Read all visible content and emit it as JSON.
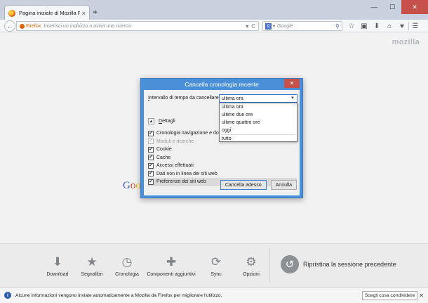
{
  "window": {
    "tab_title": "Pagina iniziale di Mozilla Fir...",
    "tab_close": "×",
    "new_tab": "+",
    "controls": {
      "minimize": "—",
      "maximize": "☐",
      "close": "✕"
    }
  },
  "navbar": {
    "back": "←",
    "identity": "Firefox",
    "url_placeholder": "Inserisci un indirizzo o avvia una ricerca",
    "reload": "C",
    "dropdown": "▾",
    "search_engine": "g",
    "search_placeholder": "Google",
    "search_go": "⚲",
    "tools": {
      "bookmark": "☆",
      "reading": "▣",
      "download": "⬇",
      "home": "⌂",
      "pocket": "♥",
      "menu": "☰"
    }
  },
  "content": {
    "brand": "mozilla",
    "google_logo": [
      "G",
      "o",
      "o"
    ]
  },
  "launcher": {
    "items": [
      {
        "label": "Download",
        "icon": "⬇"
      },
      {
        "label": "Segnalibri",
        "icon": "★"
      },
      {
        "label": "Cronologia",
        "icon": "◷"
      },
      {
        "label": "Componenti aggiuntivi",
        "icon": "✚"
      },
      {
        "label": "Sync",
        "icon": "⟳"
      },
      {
        "label": "Opzioni",
        "icon": "⚙"
      }
    ],
    "restore_icon": "↺",
    "restore_label": "Ripristina la sessione precedente"
  },
  "statusbar": {
    "info_icon": "i",
    "message": "Alcune informazioni vengono inviate automaticamente a Mozilla da Firefox per migliorare l'utilizzo.",
    "choose_button": "Scegli cosa condividere",
    "close": "✕"
  },
  "dialog": {
    "title": "Cancella cronologia recente",
    "close": "✕",
    "range_label_prefix": "I",
    "range_label_rest": "ntervallo di tempo da cancellare:",
    "selected_range": "ultima ora",
    "range_options": [
      "ultima ora",
      "ultime due ore",
      "ultime quattro ore",
      "oggi",
      "tutto"
    ],
    "details_toggle": "▲",
    "details_prefix": "D",
    "details_rest": "ettagli",
    "checks": [
      {
        "label": "Cronologia navigazione e download",
        "checked": "✔",
        "disabled": false
      },
      {
        "label": "Moduli e ricerche",
        "checked": "✔",
        "disabled": true
      },
      {
        "label": "Cookie",
        "checked": "✔",
        "disabled": false
      },
      {
        "label": "Cache",
        "checked": "✔",
        "disabled": false
      },
      {
        "label": "Accessi effettuati",
        "checked": "✔",
        "disabled": false
      },
      {
        "label": "Dati non in linea dei siti web",
        "checked": "✔",
        "disabled": false
      },
      {
        "label": "Preferenze dei siti web",
        "checked": "✔",
        "disabled": false
      }
    ],
    "clear_button": "Cancella adesso",
    "cancel_button": "Annulla"
  }
}
